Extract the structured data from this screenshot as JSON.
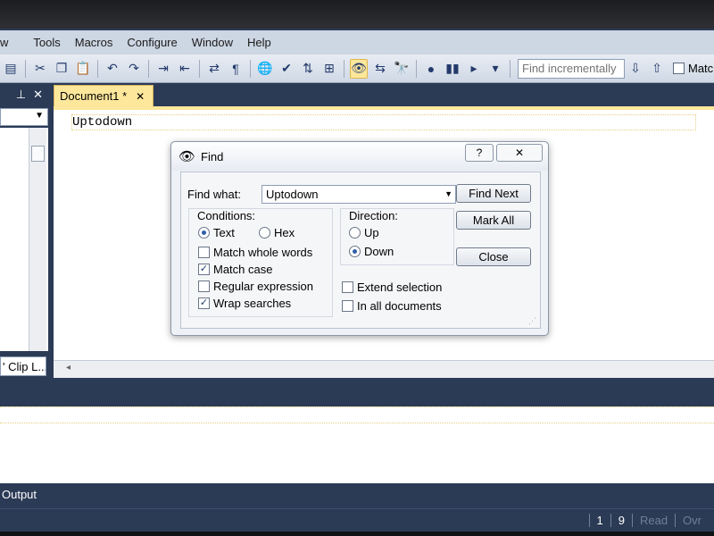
{
  "menu": [
    "w",
    "Tools",
    "Macros",
    "Configure",
    "Window",
    "Help"
  ],
  "toolbar": {
    "find_incremental_placeholder": "Find incrementally",
    "match_label": "Matc"
  },
  "left_panel": {
    "pin_icon": "pin-icon",
    "close_icon": "close-icon",
    "bottom_tab": "' Clip L..."
  },
  "document": {
    "tab_label": "Document1 *",
    "tab_close": "✕",
    "content": "Uptodown"
  },
  "dialog": {
    "title": "Find",
    "help_label": "?",
    "close_label": "✕",
    "find_what_label": "Find what:",
    "find_what_value": "Uptodown",
    "conditions_label": "Conditions:",
    "text_label": "Text",
    "hex_label": "Hex",
    "match_whole_words": "Match whole words",
    "match_case": "Match case",
    "regular_expression": "Regular expression",
    "wrap_searches": "Wrap searches",
    "direction_label": "Direction:",
    "up_label": "Up",
    "down_label": "Down",
    "extend_selection": "Extend selection",
    "in_all_documents": "In all documents",
    "find_next": "Find Next",
    "mark_all": "Mark All",
    "close": "Close",
    "state": {
      "text_selected": true,
      "hex_selected": false,
      "match_whole_words_checked": false,
      "match_case_checked": true,
      "regular_expression_checked": false,
      "wrap_searches_checked": true,
      "direction": "Down",
      "extend_selection_checked": false,
      "in_all_documents_checked": false
    }
  },
  "output": {
    "tab_label": "Output"
  },
  "status": {
    "line": "1",
    "col": "9",
    "read": "Read",
    "ovr": "Ovr"
  }
}
